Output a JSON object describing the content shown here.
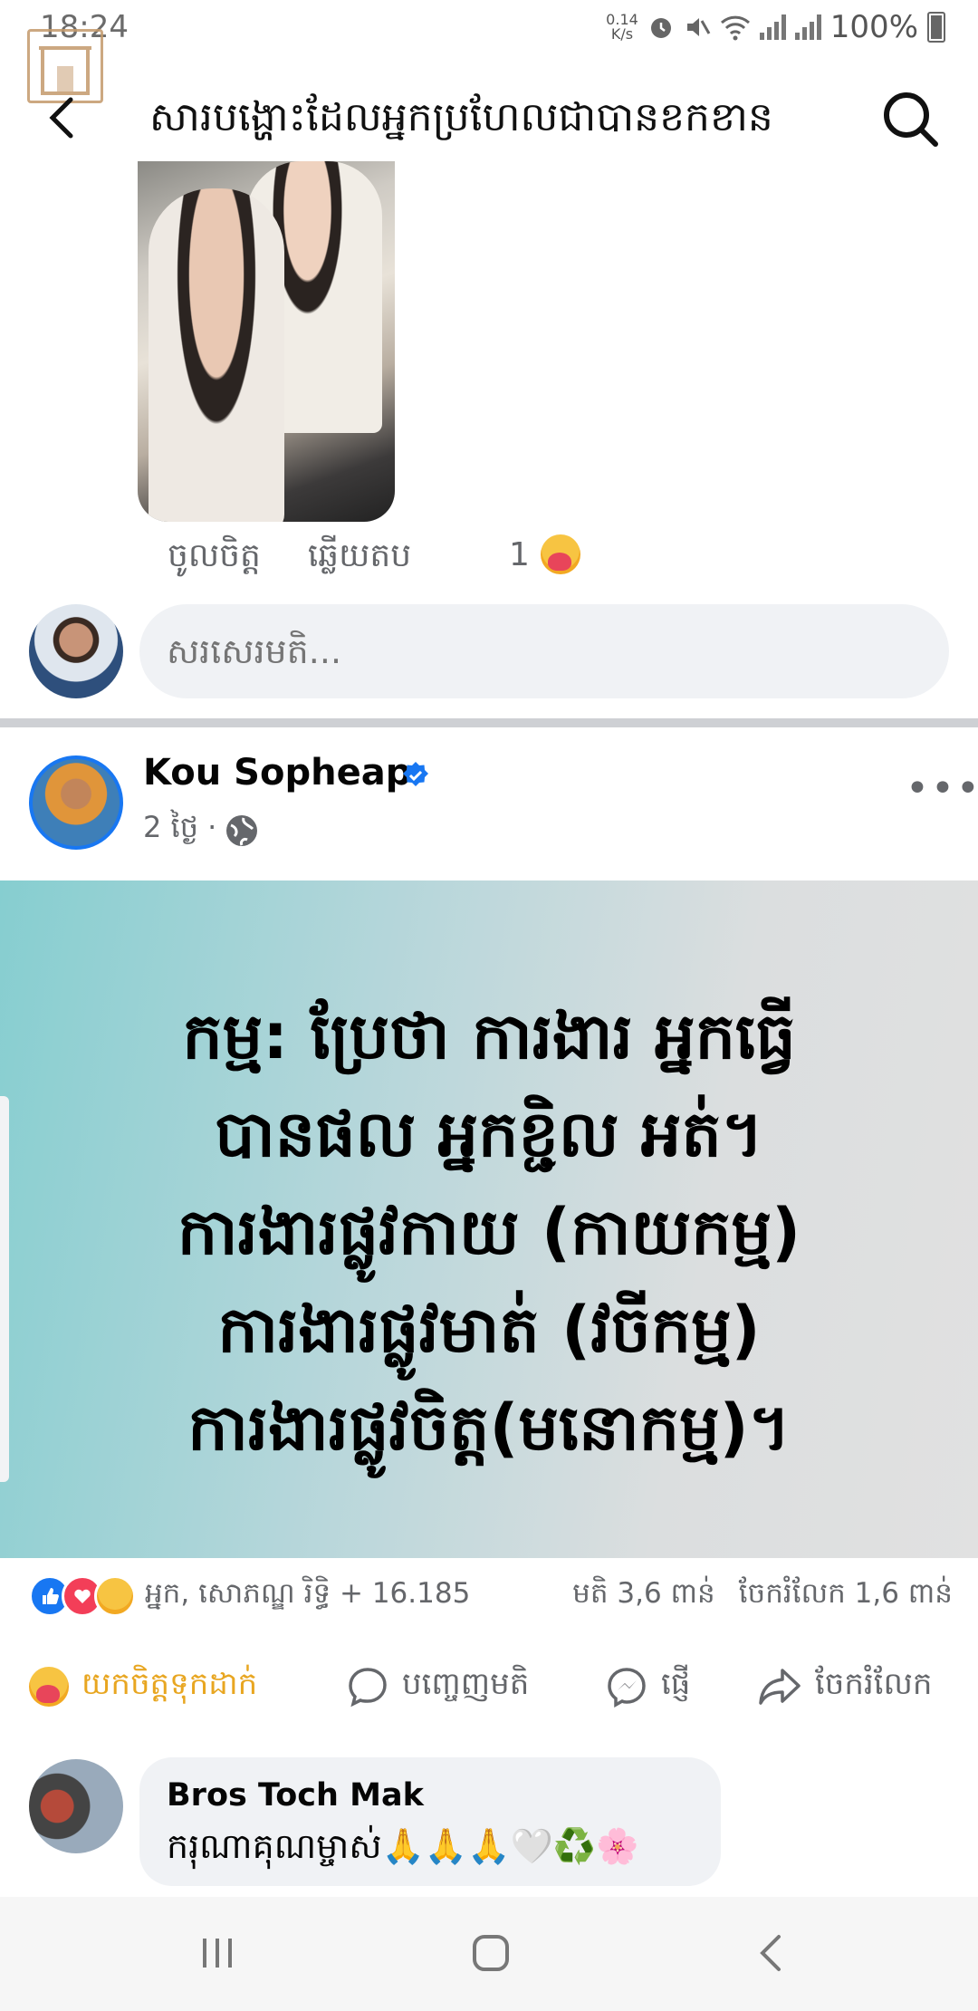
{
  "status_bar": {
    "time": "18:24",
    "speed_top": "0.14",
    "speed_bottom": "K/s",
    "battery": "100%"
  },
  "header": {
    "title": "សារបង្ហោះដែលអ្នកប្រហែលជាបានខកខាន"
  },
  "previous_reply": {
    "like_label": "ចូលចិត្ត",
    "reply_label": "ឆ្លើយតប",
    "reaction_count": "1"
  },
  "comment_box": {
    "placeholder": "សរសេរមតិ..."
  },
  "post": {
    "author": "Kou Sopheap",
    "time": "2 ថ្ងៃ ·",
    "card_lines": [
      "កម្ម: ប្រែថា ការងារ អ្នកធ្វើ",
      "បានផល អ្នកខ្ជិល អត់។",
      "ការងារផ្លូវកាយ (កាយកម្ម)",
      "ការងារផ្លូវមាត់ (វចីកម្ម)",
      "ការងារផ្លូវចិត្ត(មនោកម្ម)។"
    ],
    "reactions_summary": "អ្នក, សោភណ្ឌ រិទ្ធិ + 16.185",
    "comments_count": "មតិ 3,6 ពាន់",
    "shares_count": "ចែករំលែក 1,6 ពាន់",
    "actions": {
      "care": "យកចិត្តទុកដាក់",
      "comment": "បញ្ចេញមតិ",
      "send": "ផ្ញើ",
      "share": "ចែករំលែក"
    }
  },
  "first_comment": {
    "author": "Bros Toch Mak",
    "text": "ករុណាគុណម្ចាស់🙏🙏🙏🤍♻️🌸"
  },
  "colors": {
    "facebook_blue": "#1877f2",
    "care_yellow": "#e8a621",
    "secondary_text": "#65676b",
    "comment_bg": "#f0f2f5"
  }
}
